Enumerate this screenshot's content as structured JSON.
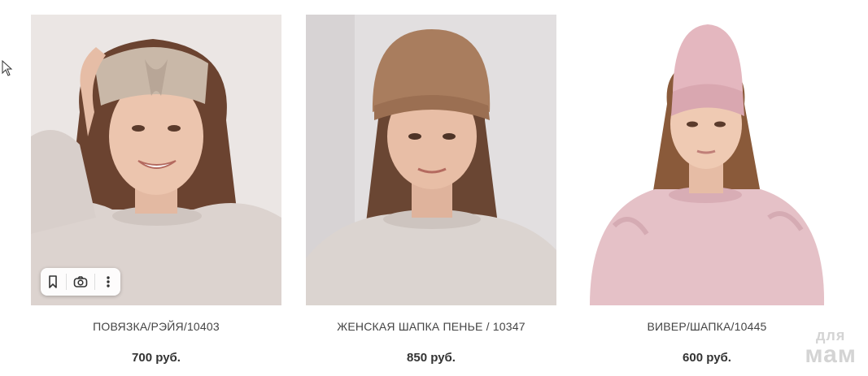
{
  "products": [
    {
      "title": "ПОВЯЗКА/РЭЙЯ/10403",
      "price": "700 руб.",
      "item": "headband",
      "color": "#c9b8a8"
    },
    {
      "title": "ЖЕНСКАЯ ШАПКА ПЕНЬЕ / 10347",
      "price": "850 руб.",
      "item": "beanie",
      "color": "#a97d5e"
    },
    {
      "title": "ВИВЕР/ШАПКА/10445",
      "price": "600 руб.",
      "item": "pink-hat",
      "color": "#e4b7bf"
    }
  ],
  "toolbar": {
    "icons": [
      "bookmark-icon",
      "camera-icon",
      "more-vertical-icon"
    ]
  },
  "watermark": {
    "line1": "для",
    "line2": "мам"
  }
}
